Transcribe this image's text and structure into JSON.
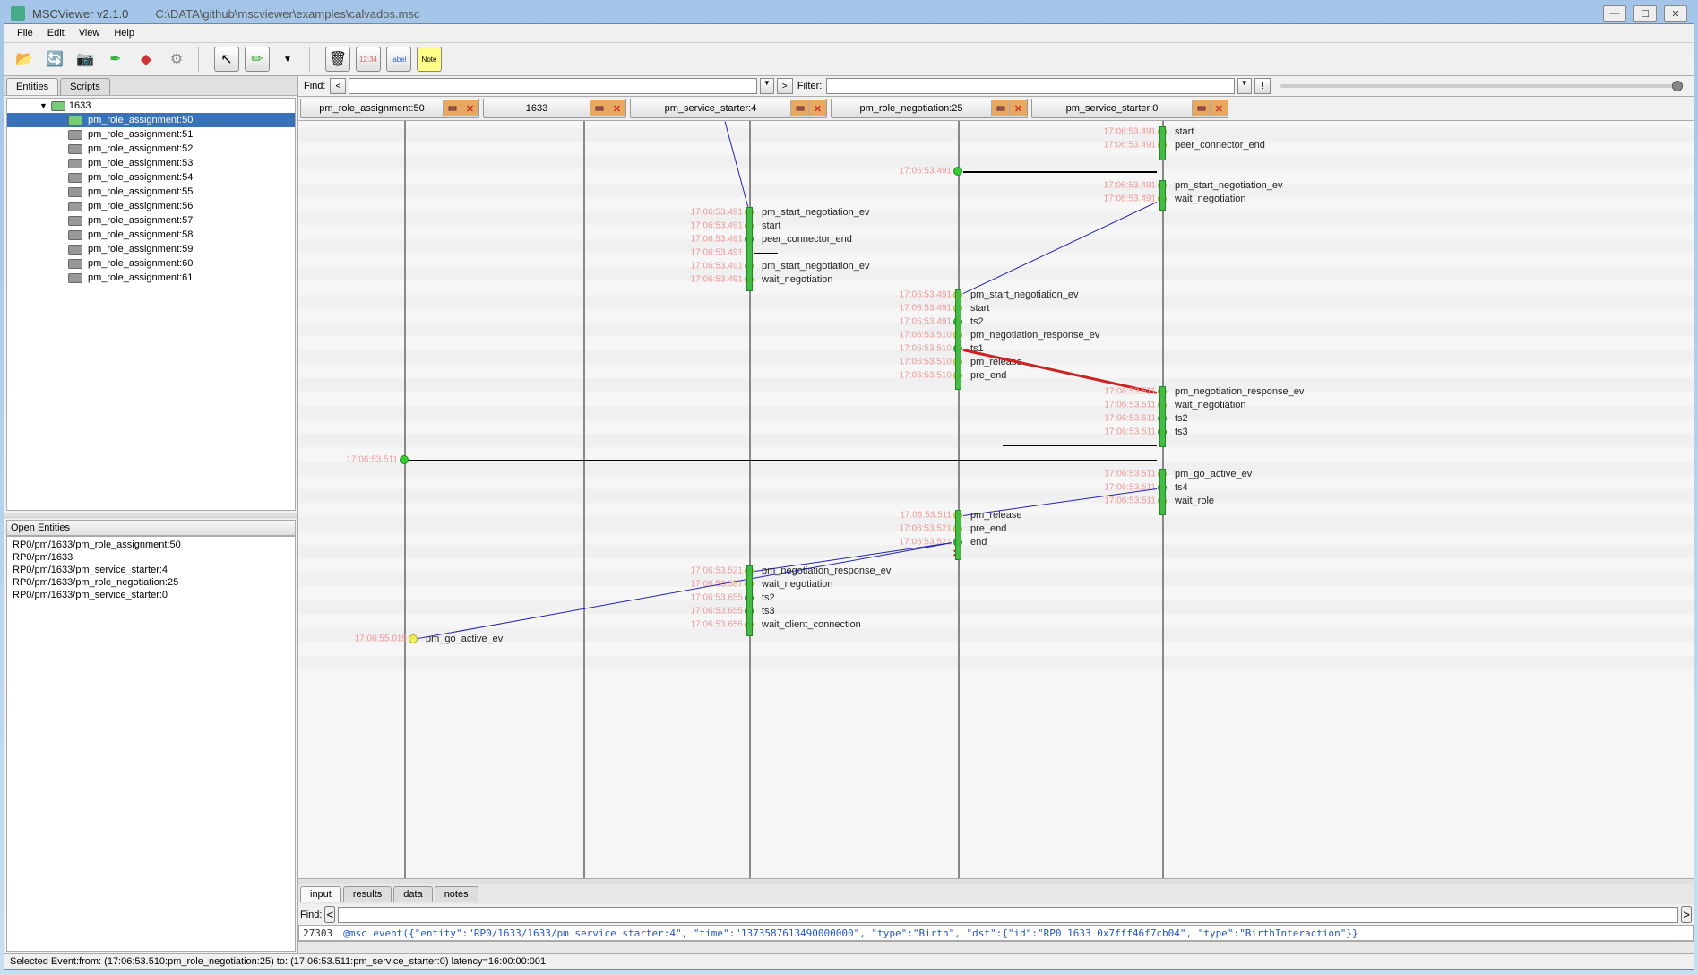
{
  "window": {
    "app_title": "MSCViewer v2.1.0",
    "file_path": "C:\\DATA\\github\\mscviewer\\examples\\calvados.msc"
  },
  "menu": {
    "file": "File",
    "edit": "Edit",
    "view": "View",
    "help": "Help"
  },
  "left_tabs": {
    "entities": "Entities",
    "scripts": "Scripts"
  },
  "tree": {
    "parent": "1633",
    "items": [
      "pm_role_assignment:50",
      "pm_role_assignment:51",
      "pm_role_assignment:52",
      "pm_role_assignment:53",
      "pm_role_assignment:54",
      "pm_role_assignment:55",
      "pm_role_assignment:56",
      "pm_role_assignment:57",
      "pm_role_assignment:58",
      "pm_role_assignment:59",
      "pm_role_assignment:60",
      "pm_role_assignment:61"
    ],
    "selected_index": 0
  },
  "open_entities": {
    "header": "Open Entities",
    "items": [
      "RP0/pm/1633/pm_role_assignment:50",
      "RP0/pm/1633",
      "RP0/pm/1633/pm_service_starter:4",
      "RP0/pm/1633/pm_role_negotiation:25",
      "RP0/pm/1633/pm_service_starter:0"
    ]
  },
  "find_bar": {
    "find_label": "Find:",
    "filter_label": "Filter:",
    "prev": "<",
    "next": ">",
    "excl": "!"
  },
  "entity_headers": [
    {
      "label": "pm_role_assignment:50"
    },
    {
      "label": "1633"
    },
    {
      "label": "pm_service_starter:4"
    },
    {
      "label": "pm_role_negotiation:25"
    },
    {
      "label": "pm_service_starter:0"
    }
  ],
  "events": {
    "col2_ts": [
      "17:06:53.491",
      "17:06:53.491",
      "17:06:53.491",
      "17:06:53.491",
      "17:06:53.491",
      "17:06:53.491"
    ],
    "col2_labels": [
      "pm_start_negotiation_ev",
      "start",
      "peer_connector_end",
      "",
      "pm_start_negotiation_ev",
      "wait_negotiation"
    ],
    "col2b_ts": [
      "17:06:53.521",
      "17:06:53.587",
      "17:06:53.655",
      "17:06:53.655",
      "17:06:53.656"
    ],
    "col2b_labels": [
      "pm_negotiation_response_ev",
      "wait_negotiation",
      "ts2",
      "ts3",
      "wait_client_connection"
    ],
    "col3_ts": [
      "17:06:53.491",
      "17:06:53.491",
      "17:06:53.491",
      "17:06:53.510",
      "17:06:53.510",
      "17:06:53.510",
      "17:06:53.510"
    ],
    "col3_labels": [
      "pm_start_negotiation_ev",
      "start",
      "ts2",
      "pm_negotiation_response_ev",
      "ts1",
      "pm_release",
      "pre_end"
    ],
    "col3b_ts": [
      "17:06:53.511",
      "17:06:53.521",
      "17:06:53.521"
    ],
    "col3b_labels": [
      "pm_release",
      "pre_end",
      "end"
    ],
    "col4_ts": [
      "17:06:53.491",
      "17:06:53.491"
    ],
    "col4_top_labels": [
      "start",
      "peer_connector_end"
    ],
    "col4_ts2": [
      "17:06:53.491",
      "17:06:53.491"
    ],
    "col4_labels2": [
      "pm_start_negotiation_ev",
      "wait_negotiation"
    ],
    "col4_ts3": [
      "17:06:53.511",
      "17:06:53.511",
      "17:06:53.511",
      "17:06:53.511"
    ],
    "col4_labels3": [
      "pm_negotiation_response_ev",
      "wait_negotiation",
      "ts2",
      "ts3"
    ],
    "col4_ts4": [
      "17:06:53.511",
      "17:06:53.511",
      "17:06:53.511"
    ],
    "col4_labels4": [
      "pm_go_active_ev",
      "ts4",
      "wait_role"
    ],
    "col0_ts1": "17:06:53.491",
    "col0_ts2": "17:06:53.511",
    "col0_ts3": "17:06:55.019",
    "col0_label": "pm_go_active_ev"
  },
  "bottom_tabs": {
    "input": "input",
    "results": "results",
    "data": "data",
    "notes": "notes"
  },
  "bottom_find": {
    "label": "Find:",
    "prev": "<",
    "next": ">"
  },
  "log": {
    "line_no": "27303",
    "content": "@msc_event({\"entity\":\"RP0/1633/1633/pm_service_starter:4\", \"time\":\"1373587613490000000\", \"type\":\"Birth\", \"dst\":{\"id\":\"RP0_1633_0x7fff46f7cb04\", \"type\":\"BirthInteraction\"}}"
  },
  "status": "Selected Event:from: (17:06:53.510:pm_role_negotiation:25) to: (17:06:53.511:pm_service_starter:0) latency=16:00:00:001"
}
